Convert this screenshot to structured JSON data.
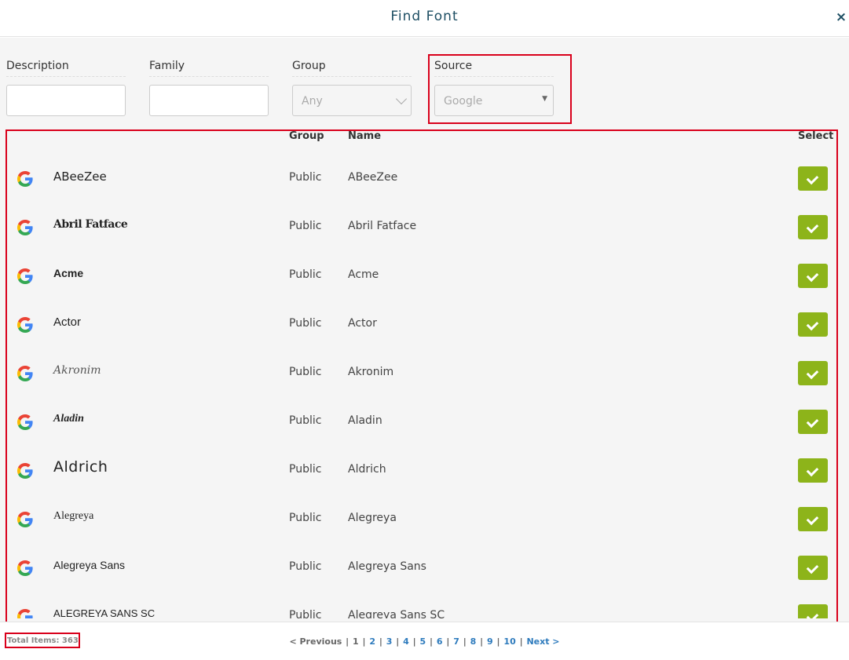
{
  "dialog": {
    "title": "Find Font",
    "close_glyph": "×"
  },
  "filters": {
    "description": {
      "label": "Description",
      "value": ""
    },
    "family": {
      "label": "Family",
      "value": ""
    },
    "group": {
      "label": "Group",
      "value": "Any"
    },
    "source": {
      "label": "Source",
      "value": "Google"
    }
  },
  "table": {
    "columns": {
      "group": "Group",
      "name": "Name",
      "select": "Select"
    },
    "rows": [
      {
        "preview": "ABeeZee",
        "group": "Public",
        "name": "ABeeZee"
      },
      {
        "preview": "Abril Fatface",
        "group": "Public",
        "name": "Abril Fatface"
      },
      {
        "preview": "Acme",
        "group": "Public",
        "name": "Acme"
      },
      {
        "preview": "Actor",
        "group": "Public",
        "name": "Actor"
      },
      {
        "preview": "Akronim",
        "group": "Public",
        "name": "Akronim"
      },
      {
        "preview": "Aladin",
        "group": "Public",
        "name": "Aladin"
      },
      {
        "preview": "Aldrich",
        "group": "Public",
        "name": "Aldrich"
      },
      {
        "preview": "Alegreya",
        "group": "Public",
        "name": "Alegreya"
      },
      {
        "preview": "Alegreya Sans",
        "group": "Public",
        "name": "Alegreya Sans"
      },
      {
        "preview": "Alegreya Sans SC",
        "group": "Public",
        "name": "Alegreya Sans SC"
      }
    ]
  },
  "footer": {
    "total": "Total Items: 363",
    "pager": {
      "prev": "< Previous",
      "current": "1",
      "pages": [
        "2",
        "3",
        "4",
        "5",
        "6",
        "7",
        "8",
        "9",
        "10"
      ],
      "next": "Next >"
    }
  },
  "colors": {
    "select_button": "#8db41a",
    "highlight": "#d9001b",
    "title": "#1d4e63"
  }
}
